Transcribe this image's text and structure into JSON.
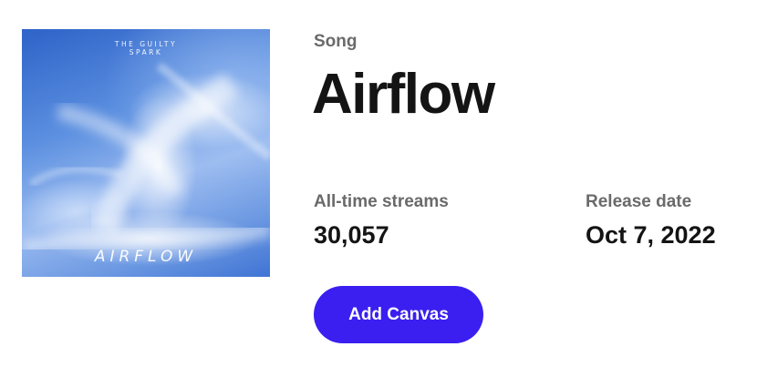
{
  "cover": {
    "artist_text": "THE GUILTY\nSPARK",
    "title_text": "AIRFLOW"
  },
  "song": {
    "type_label": "Song",
    "title": "Airflow"
  },
  "stats": {
    "streams_label": "All-time streams",
    "streams_value": "30,057",
    "release_label": "Release date",
    "release_value": "Oct 7, 2022"
  },
  "actions": {
    "add_canvas_label": "Add Canvas"
  },
  "colors": {
    "accent": "#3a1ff0",
    "text_primary": "#141414",
    "text_secondary": "#6a6a6a"
  }
}
